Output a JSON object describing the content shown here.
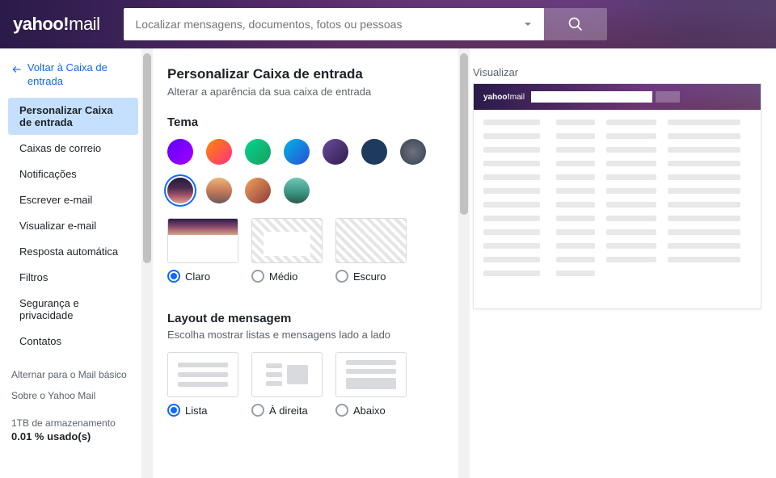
{
  "logo": {
    "brand": "yahoo!",
    "product": "mail"
  },
  "search": {
    "placeholder": "Localizar mensagens, documentos, fotos ou pessoas"
  },
  "sidebar": {
    "back": "Voltar à Caixa de entrada",
    "items": [
      "Personalizar Caixa de entrada",
      "Caixas de correio",
      "Notificações",
      "Escrever e-mail",
      "Visualizar e-mail",
      "Resposta automática",
      "Filtros",
      "Segurança e privacidade",
      "Contatos"
    ],
    "switch_basic": "Alternar para o Mail básico",
    "about": "Sobre o Yahoo Mail",
    "storage_total": "1TB de armazenamento",
    "storage_used": "0.01 % usado(s)"
  },
  "settings": {
    "title": "Personalizar Caixa de entrada",
    "subtitle": "Alterar a aparência da sua caixa de entrada",
    "theme_heading": "Tema",
    "mode": {
      "light": "Claro",
      "medium": "Médio",
      "dark": "Escuro"
    },
    "layout_heading": "Layout de mensagem",
    "layout_subtitle": "Escolha mostrar listas e mensagens lado a lado",
    "layout": {
      "list": "Lista",
      "right": "À direita",
      "below": "Abaixo"
    }
  },
  "preview": {
    "label": "Visualizar"
  }
}
